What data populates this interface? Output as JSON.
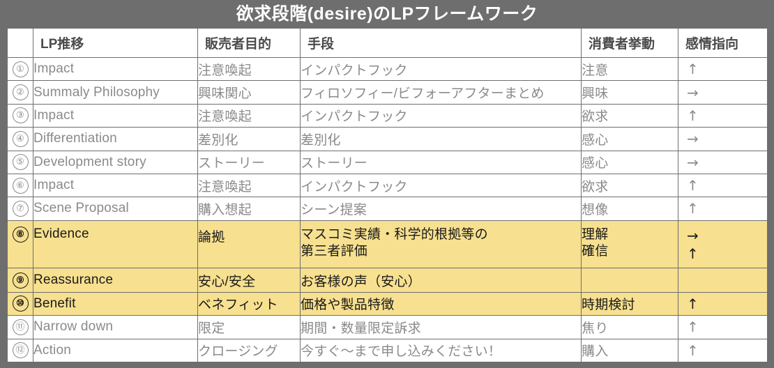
{
  "title": "欲求段階(desire)のLPフレームワーク",
  "colors": {
    "header_band": "#6e6e6e",
    "title_text": "#ffffff",
    "grid_line": "#6e6e6e",
    "body_text": "#8a8a8a",
    "highlight_row": "#f7e08f",
    "highlight_text": "#1a1a1a"
  },
  "columns": [
    {
      "key": "num",
      "label": ""
    },
    {
      "key": "lp",
      "label": "LP推移"
    },
    {
      "key": "goal",
      "label": "販売者目的"
    },
    {
      "key": "means",
      "label": "手段"
    },
    {
      "key": "beh",
      "label": "消費者挙動"
    },
    {
      "key": "emo",
      "label": "感情指向"
    }
  ],
  "rows": [
    {
      "num": "①",
      "lp": "Impact",
      "goal": "注意喚起",
      "means": "インパクトフック",
      "beh": "注意",
      "emo": "↑",
      "highlight": false
    },
    {
      "num": "②",
      "lp": "Summaly Philosophy",
      "goal": "興味関心",
      "means": "フィロソフィー/ビフォーアフターまとめ",
      "beh": "興味",
      "emo": "→",
      "highlight": false
    },
    {
      "num": "③",
      "lp": "Impact",
      "goal": "注意喚起",
      "means": "インパクトフック",
      "beh": "欲求",
      "emo": "↑",
      "highlight": false
    },
    {
      "num": "④",
      "lp": "Differentiation",
      "goal": "差別化",
      "means": "差別化",
      "beh": "感心",
      "emo": "→",
      "highlight": false
    },
    {
      "num": "⑤",
      "lp": "Development story",
      "goal": "ストーリー",
      "means": "ストーリー",
      "beh": "感心",
      "emo": "→",
      "highlight": false
    },
    {
      "num": "⑥",
      "lp": "Impact",
      "goal": "注意喚起",
      "means": "インパクトフック",
      "beh": "欲求",
      "emo": "↑",
      "highlight": false
    },
    {
      "num": "⑦",
      "lp": "Scene Proposal",
      "goal": "購入想起",
      "means": "シーン提案",
      "beh": "想像",
      "emo": "↑",
      "highlight": false
    },
    {
      "num": "⑧",
      "lp": "Evidence",
      "goal": "論拠",
      "means_line1": "マスコミ実績・科学的根拠等の",
      "means_line2": "第三者評価",
      "beh_line1": "理解",
      "beh_line2": "確信",
      "emo_line1": "→",
      "emo_line2": "↑",
      "highlight": true
    },
    {
      "num": "⑨",
      "lp": "Reassurance",
      "goal": "安心/安全",
      "means": "お客様の声（安心）",
      "beh": "",
      "emo": "",
      "highlight": true
    },
    {
      "num": "⑩",
      "lp": "Benefit",
      "goal": "ベネフィット",
      "means": "価格や製品特徴",
      "beh": "時期検討",
      "emo": "↑",
      "highlight": true
    },
    {
      "num": "⑪",
      "lp": "Narrow down",
      "goal": "限定",
      "means": "期間・数量限定訴求",
      "beh": "焦り",
      "emo": "↑",
      "highlight": false
    },
    {
      "num": "⑫",
      "lp": "Action",
      "goal": "クロージング",
      "means": "今すぐ〜まで申し込みください！",
      "beh": "購入",
      "emo": "↑",
      "highlight": false
    }
  ]
}
